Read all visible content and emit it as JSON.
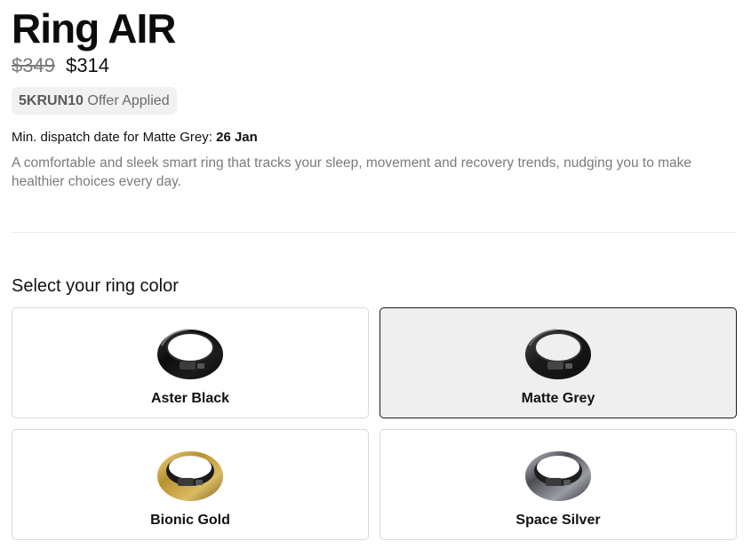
{
  "product": {
    "title": "Ring AIR",
    "price_original": "$349",
    "price_current": "$314"
  },
  "offer": {
    "code": "5KRUN10",
    "text": "Offer Applied"
  },
  "dispatch": {
    "label": "Min. dispatch date for Matte Grey:",
    "date": "26 Jan"
  },
  "description": "A comfortable and sleek smart ring that tracks your sleep, movement and recovery trends, nudging you to make healthier choices every day.",
  "color_selector": {
    "heading": "Select your ring color",
    "selected": "Matte Grey",
    "options": [
      {
        "label": "Aster Black",
        "icon": "ring-aster-black-icon",
        "color": "#111111"
      },
      {
        "label": "Matte Grey",
        "icon": "ring-matte-grey-icon",
        "color": "#2a2a2a"
      },
      {
        "label": "Bionic Gold",
        "icon": "ring-bionic-gold-icon",
        "color": "#c9a74a"
      },
      {
        "label": "Space Silver",
        "icon": "ring-space-silver-icon",
        "color": "#7d8085"
      }
    ]
  }
}
